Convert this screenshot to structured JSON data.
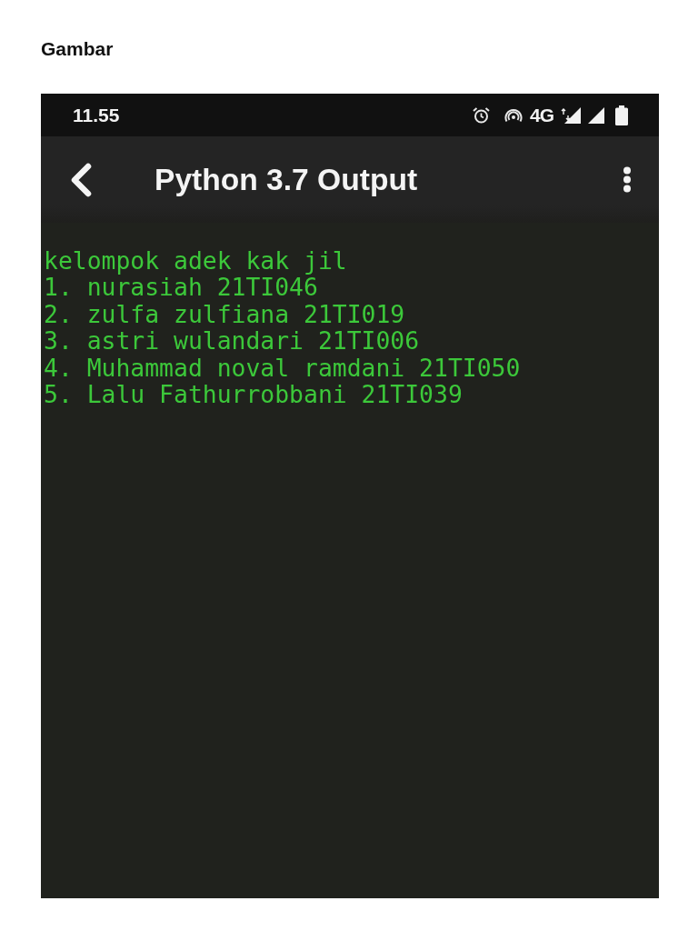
{
  "page_heading": "Gambar",
  "phone": {
    "status_bar": {
      "time": "11.55",
      "network": "4G"
    },
    "app_bar": {
      "title": "Python 3.7 Output"
    },
    "console": {
      "lines": [
        "kelompok adek kak jil",
        "1. nurasiah 21TI046",
        "2. zulfa zulfiana 21TI019",
        "3. astri wulandari 21TI006",
        "4. Muhammad noval ramdani 21TI050",
        "5. Lalu Fathurrobbani 21TI039"
      ]
    }
  }
}
